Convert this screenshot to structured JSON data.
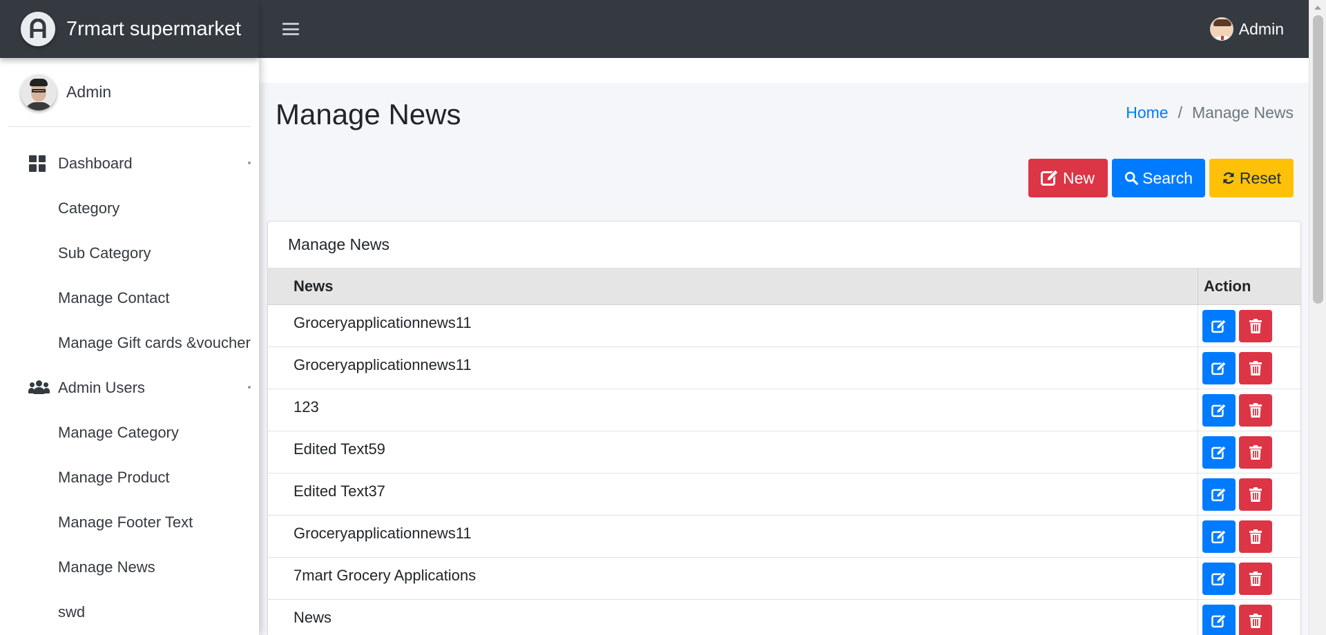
{
  "brand": {
    "name": "7rmart supermarket"
  },
  "navbar": {
    "user_name": "Admin"
  },
  "sidebar": {
    "user_name": "Admin",
    "items": [
      {
        "label": "Dashboard",
        "icon": "grid-icon"
      },
      {
        "label": "Category"
      },
      {
        "label": "Sub Category"
      },
      {
        "label": "Manage Contact"
      },
      {
        "label": "Manage Gift cards &voucher"
      },
      {
        "label": "Admin Users",
        "icon": "users-icon"
      },
      {
        "label": "Manage Category"
      },
      {
        "label": "Manage Product"
      },
      {
        "label": "Manage Footer Text"
      },
      {
        "label": "Manage News"
      },
      {
        "label": "swd"
      }
    ]
  },
  "page": {
    "title": "Manage News",
    "breadcrumb": {
      "home": "Home",
      "separator": "/",
      "current": "Manage News"
    }
  },
  "actions": {
    "new_label": "New",
    "search_label": "Search",
    "reset_label": "Reset"
  },
  "card": {
    "title": "Manage News",
    "columns": [
      "News",
      "Action"
    ],
    "rows": [
      "Groceryapplicationnews11",
      "Groceryapplicationnews11",
      "123",
      "Edited Text59",
      "Edited Text37",
      "Groceryapplicationnews11",
      "7mart Grocery Applications",
      "News"
    ]
  },
  "colors": {
    "primary": "#007bff",
    "danger": "#dc3545",
    "warning": "#ffc107",
    "dark": "#343a40"
  }
}
